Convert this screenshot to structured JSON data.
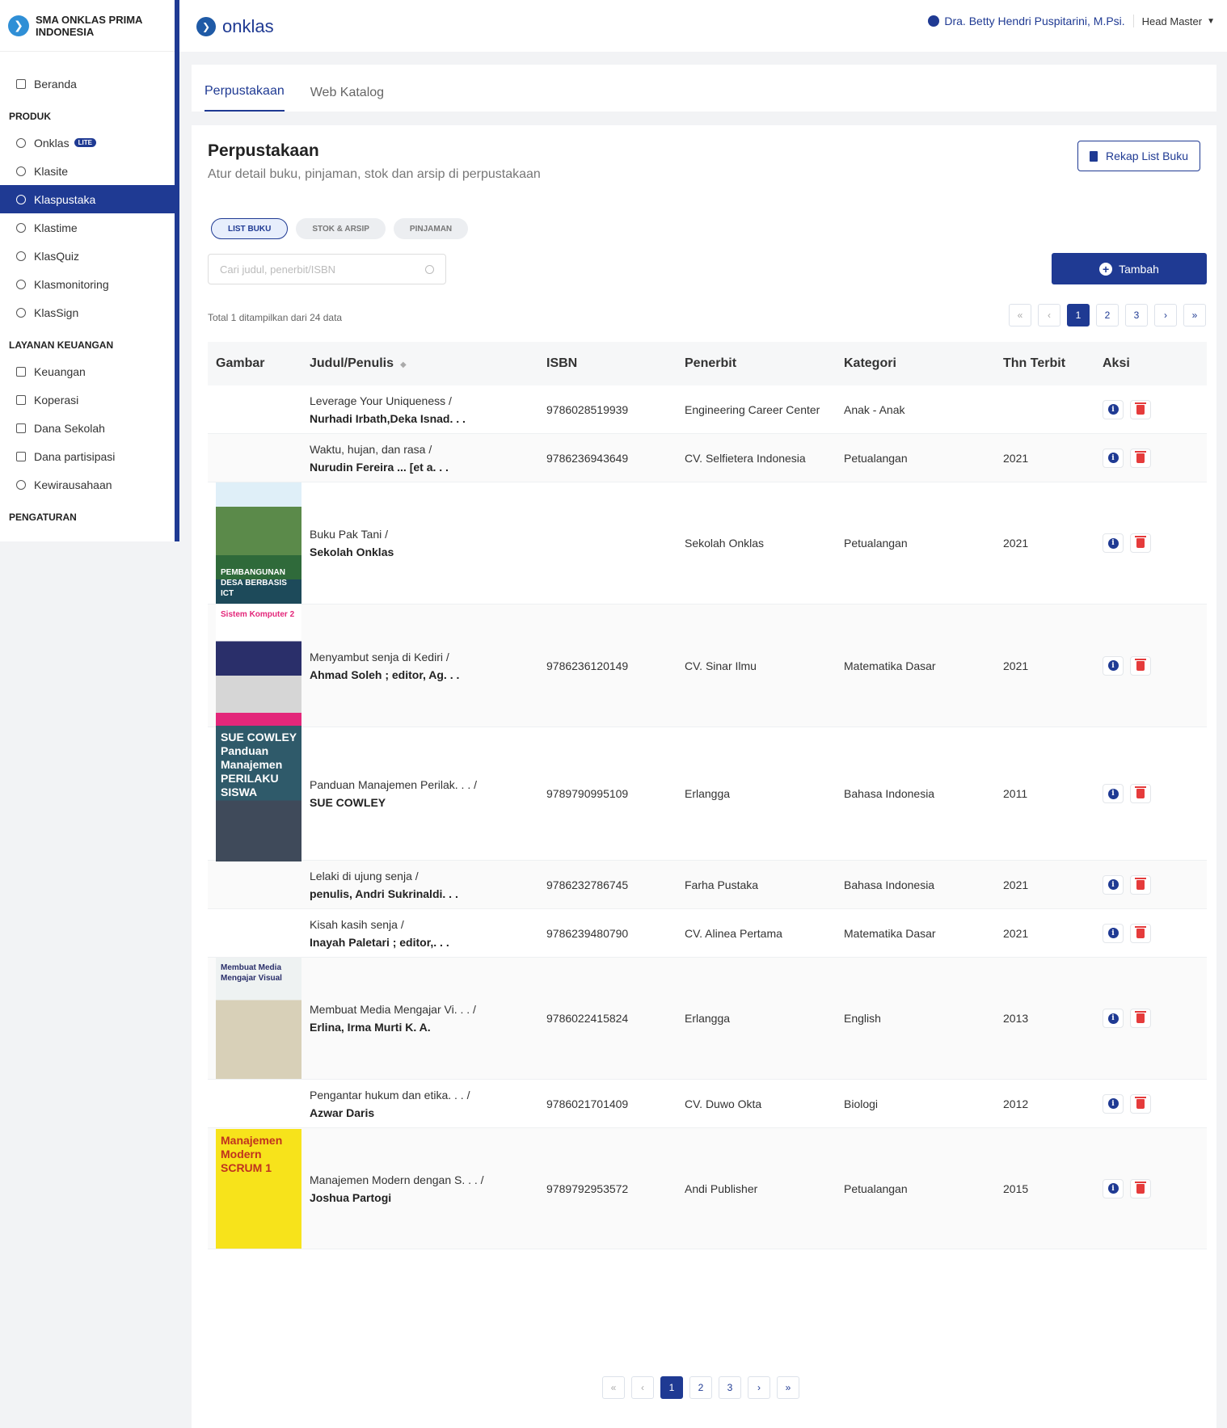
{
  "sidebar": {
    "brand": "SMA ONKLAS PRIMA INDONESIA",
    "home": "Beranda",
    "section_produk": "PRODUK",
    "produk_items": [
      "Onklas",
      "Klasite",
      "Klaspustaka",
      "Klastime",
      "KlasQuiz",
      "Klasmonitoring",
      "KlasSign"
    ],
    "lite_badge": "LITE",
    "section_keuangan": "LAYANAN KEUANGAN",
    "keuangan_items": [
      "Keuangan",
      "Koperasi",
      "Dana Sekolah",
      "Dana partisipasi",
      "Kewirausahaan"
    ],
    "section_pengaturan": "PENGATURAN",
    "active_item": "Klaspustaka"
  },
  "topbar": {
    "logo_text": "onklas",
    "user_name": "Dra. Betty Hendri Puspitarini, M.Psi.",
    "user_role": "Head Master"
  },
  "tabs": [
    "Perpustakaan",
    "Web Katalog"
  ],
  "page": {
    "title": "Perpustakaan",
    "subtitle": "Atur detail buku, pinjaman, stok dan arsip di perpustakaan",
    "rekap_label": "Rekap List Buku",
    "pills": [
      "LIST BUKU",
      "STOK & ARSIP",
      "PINJAMAN"
    ],
    "search_placeholder": "Cari judul, penerbit/ISBN",
    "add_label": "Tambah",
    "total_text": "Total 1 ditampilkan dari 24 data"
  },
  "pagination": {
    "first": "«",
    "prev": "‹",
    "pages": [
      "1",
      "2",
      "3"
    ],
    "next": "›",
    "last": "»",
    "current": "1"
  },
  "table": {
    "headers": [
      "Gambar",
      "Judul/Penulis",
      "ISBN",
      "Penerbit",
      "Kategori",
      "Thn Terbit",
      "Aksi"
    ],
    "rows": [
      {
        "title": "Leverage Your Uniqueness /",
        "author": "Nurhadi Irbath,Deka Isnad. . .",
        "isbn": "9786028519939",
        "publisher": "Engineering Career Center",
        "category": "Anak - Anak",
        "year": ""
      },
      {
        "title": "Waktu, hujan, dan rasa /",
        "author": "Nurudin Fereira ... [et a. . .",
        "isbn": "9786236943649",
        "publisher": "CV. Selfietera Indonesia",
        "category": "Petualangan",
        "year": "2021"
      },
      {
        "title": "Buku Pak Tani /",
        "author": "Sekolah Onklas",
        "isbn": "",
        "publisher": "Sekolah Onklas",
        "category": "Petualangan",
        "year": "2021",
        "cover": "PEMBANGUNAN DESA BERBASIS ICT"
      },
      {
        "title": "Menyambut senja di Kediri /",
        "author": "Ahmad Soleh ; editor, Ag. . .",
        "isbn": "9786236120149",
        "publisher": "CV. Sinar Ilmu",
        "category": "Matematika Dasar",
        "year": "2021",
        "cover": "Sistem Komputer 2"
      },
      {
        "title": "Panduan Manajemen Perilak. . . /",
        "author": "SUE COWLEY",
        "isbn": "9789790995109",
        "publisher": "Erlangga",
        "category": "Bahasa Indonesia",
        "year": "2011",
        "cover": "SUE COWLEY Panduan Manajemen PERILAKU SISWA"
      },
      {
        "title": "Lelaki di ujung senja /",
        "author": "penulis, Andri Sukrinaldi. . .",
        "isbn": "9786232786745",
        "publisher": "Farha Pustaka",
        "category": "Bahasa Indonesia",
        "year": "2021"
      },
      {
        "title": "Kisah kasih senja /",
        "author": "Inayah Paletari ; editor,. . .",
        "isbn": "9786239480790",
        "publisher": "CV. Alinea Pertama",
        "category": "Matematika Dasar",
        "year": "2021"
      },
      {
        "title": "Membuat Media Mengajar Vi. . . /",
        "author": "Erlina, Irma Murti K. A.",
        "isbn": "9786022415824",
        "publisher": "Erlangga",
        "category": "English",
        "year": "2013",
        "cover": "Membuat Media Mengajar Visual"
      },
      {
        "title": "Pengantar hukum dan etika. . . /",
        "author": "Azwar Daris",
        "isbn": "9786021701409",
        "publisher": "CV. Duwo Okta",
        "category": "Biologi",
        "year": "2012"
      },
      {
        "title": "Manajemen Modern dengan S. . . /",
        "author": "Joshua Partogi",
        "isbn": "9789792953572",
        "publisher": "Andi Publisher",
        "category": "Petualangan",
        "year": "2015",
        "cover": "Manajemen Modern SCRUM 1"
      }
    ]
  },
  "colors": {
    "primary": "#1f3a93",
    "danger": "#e53b3b"
  }
}
